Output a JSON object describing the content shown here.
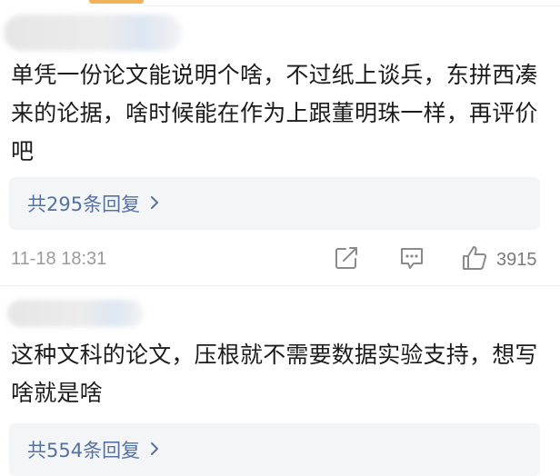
{
  "comments": [
    {
      "text": "单凭一份论文能说明个啥，不过纸上谈兵，东拼西凑来的论据，啥时候能在作为上跟董明珠一样，再评价吧",
      "replies_label": "共295条回复",
      "timestamp": "11-18 18:31",
      "like_count": "3915"
    },
    {
      "text": "这种文科的论文，压根就不需要数据实验支持，想写啥就是啥",
      "replies_label": "共554条回复"
    }
  ],
  "icons": {
    "share": "share-icon",
    "comment": "comment-icon",
    "like": "thumbs-up-icon",
    "chevron": "chevron-right-icon"
  },
  "colors": {
    "reply_link": "#5572a0",
    "reply_bg": "#f4f5f7",
    "meta_text": "#9a9a9a",
    "top_tab": "#f0b35a"
  }
}
